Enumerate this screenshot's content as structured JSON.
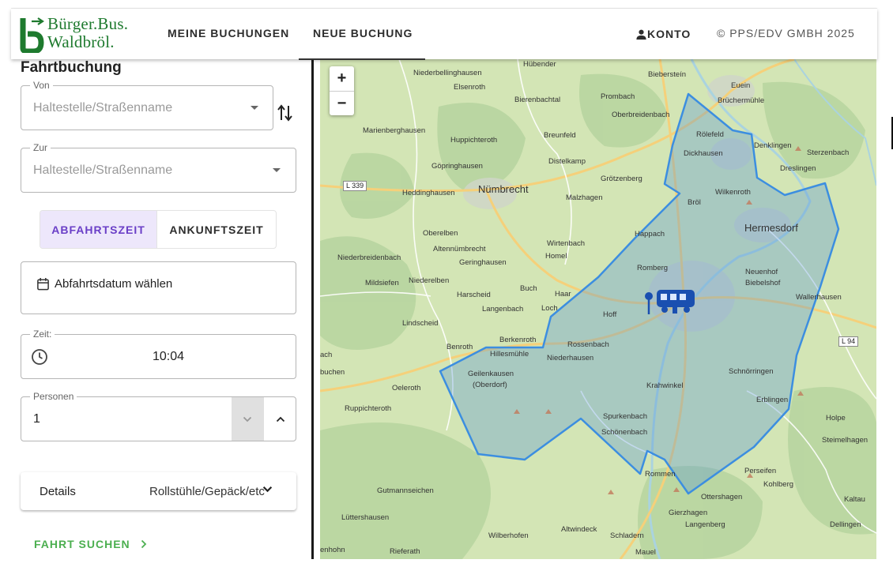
{
  "header": {
    "logo_line1": "Bürger.Bus.",
    "logo_line2": "Waldbröl.",
    "nav": [
      "MEINE BUCHUNGEN",
      "NEUE BUCHUNG"
    ],
    "account": "KONTO",
    "copyright": "© PPS/EDV GMBH 2025"
  },
  "form": {
    "title": "Fahrtbuchung",
    "from": {
      "legend": "Von",
      "placeholder": "Haltestelle/Straßenname"
    },
    "to": {
      "legend": "Zur",
      "placeholder": "Haltestelle/Straßenname"
    },
    "toggle": {
      "departure": "ABFAHRTSZEIT",
      "arrival": "ANKUNFTSZEIT",
      "selected": "departure"
    },
    "date": {
      "label": "Abfahrtsdatum wählen"
    },
    "time": {
      "legend": "Zeit:",
      "value": "10:04"
    },
    "persons": {
      "legend": "Personen",
      "value": "1"
    },
    "details": {
      "label": "Details",
      "value": "Rollstühle/Gepäck/etc"
    },
    "search_label": "FAHRT SUCHEN"
  },
  "map": {
    "zoom_in": "+",
    "zoom_out": "−",
    "road_shields": [
      "L 339",
      "L 94"
    ],
    "places": [
      "Hübender",
      "Biebersteín",
      "Niederbellinghausen",
      "Elsenroth",
      "Euein",
      "Brüchermühle",
      "Bierenbachtal",
      "Prombach",
      "Oberbreidenbach",
      "Rölefeld",
      "Denklingen",
      "Sterzenbach",
      "Marienberghausen",
      "Huppichteroth",
      "Breunfeld",
      "Dickhausen",
      "Dreslingen",
      "Distelkamp",
      "Göpringhausen",
      "Grötzenberg",
      "Heddinghausen",
      "Nümbrecht",
      "Malzhagen",
      "Wilkenroth",
      "Bröl",
      "Oberelben",
      "Hermesdorf",
      "Altennümbrecht",
      "Wirtenbach",
      "Happach",
      "Niederbreidenbach",
      "Geringhausen",
      "Homel",
      "Romberg",
      "Neuenhof",
      "Mildsiefen",
      "Niederelben",
      "Biebelshof",
      "Harscheid",
      "Buch",
      "Haar",
      "Wallerhausen",
      "Langenbach",
      "Loch",
      "Hoff",
      "Lindscheid",
      "Benroth",
      "Berkenroth",
      "Rossenbach",
      "Hillesmühle",
      "Niederhausen",
      "Geilenkausen",
      "(Oberdorf)",
      "Schnörringen",
      "Krahwinkel",
      "Oeleroth",
      "Erblingen",
      "Ruppichteroth",
      "Spurkenbach",
      "Holpe",
      "Schönenbach",
      "Steimelhagen",
      "Rommen",
      "Perseifen",
      "Kohlberg",
      "Gutmannseichen",
      "Ottershagen",
      "Kaltau",
      "Lüttershausen",
      "Gierzhagen",
      "Dellingen",
      "Langenberg",
      "Altwindeck",
      "Wilberhofen",
      "Schladern",
      "Rieferath",
      "Mauel",
      "enhohn",
      "buchen",
      "ach"
    ]
  },
  "colors": {
    "brand_green": "#1e7a2e",
    "accent_purple": "#6a3fc7",
    "toggle_bg": "#ede7fb",
    "search_green": "#4caf50",
    "zone_stroke": "#3c8ee0",
    "bus_blue": "#1a4fb0"
  },
  "icons": [
    "bus-logo-icon",
    "person-icon",
    "swap-vert-icon",
    "dropdown-arrow-icon",
    "calendar-icon",
    "clock-icon",
    "chevron-down-icon",
    "chevron-up-icon",
    "chevron-right-icon",
    "bus-marker-icon",
    "pin-icon"
  ]
}
